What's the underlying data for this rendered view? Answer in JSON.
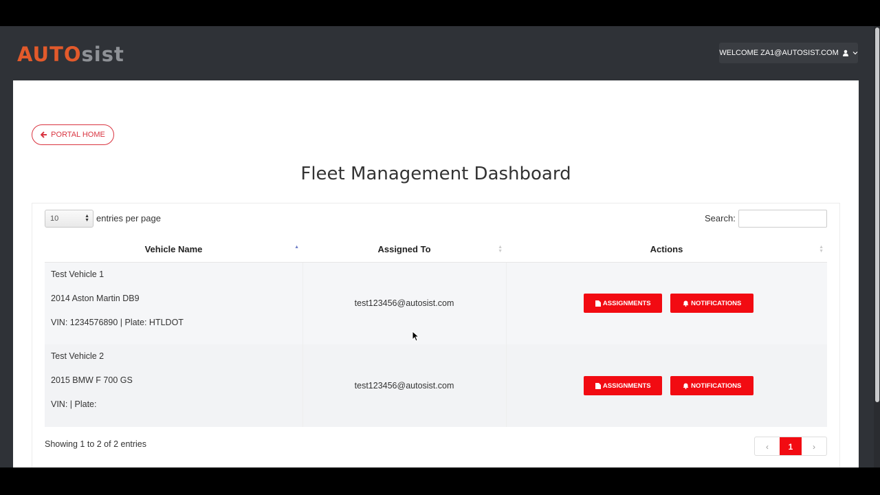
{
  "header": {
    "logo": {
      "part1": "AUTO",
      "part2": "sist"
    },
    "welcome": "WELCOME ZA1@AUTOSIST.COM"
  },
  "nav": {
    "portal_home": "PORTAL HOME"
  },
  "page": {
    "title": "Fleet Management Dashboard"
  },
  "table_controls": {
    "entries_value": "10",
    "entries_label": "entries per page",
    "search_label": "Search:"
  },
  "table": {
    "columns": [
      "Vehicle Name",
      "Assigned To",
      "Actions"
    ],
    "rows": [
      {
        "name": "Test Vehicle 1",
        "model": "2014 Aston Martin DB9",
        "ids": "VIN: 1234576890 | Plate: HTLDOT",
        "assigned": "test123456@autosist.com"
      },
      {
        "name": "Test Vehicle 2",
        "model": "2015 BMW F 700 GS",
        "ids": "VIN: | Plate:",
        "assigned": "test123456@autosist.com"
      }
    ],
    "actions": {
      "assignments": "ASSIGNMENTS",
      "notifications": "NOTIFICATIONS"
    }
  },
  "footer": {
    "info": "Showing 1 to 2 of 2 entries",
    "pagination": {
      "prev": "‹",
      "current": "1",
      "next": "›"
    }
  },
  "colors": {
    "brand_orange": "#e25a2b",
    "action_red": "#f20b12",
    "outline_red": "#d9333f",
    "header_bg": "#2f3237"
  }
}
